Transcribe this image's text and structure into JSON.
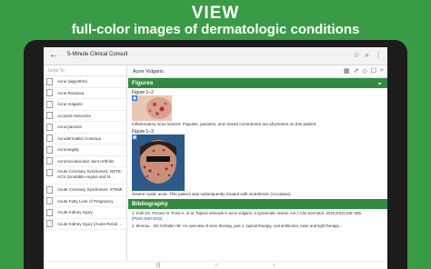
{
  "promo": {
    "headline": "VIEW",
    "subheadline": "full-color images of dermatologic conditions"
  },
  "app": {
    "title": "5-Minute Clinical Consult",
    "back_icon": "arrow-back-icon",
    "top_icons": [
      "bookmark-icon",
      "search-icon",
      "more-vert-icon"
    ]
  },
  "sidebar": {
    "jump_placeholder": "Jump To",
    "items": [
      {
        "label": "Acne (algorithm)"
      },
      {
        "label": "Acne Rosacea"
      },
      {
        "label": "Acne Vulgaris"
      },
      {
        "label": "Acoustic Neuroma"
      },
      {
        "label": "Acrocyanosis"
      },
      {
        "label": "Acrodermatitis Continua"
      },
      {
        "label": "Acromegaly"
      },
      {
        "label": "Acromioclavicular Joint Arthritis"
      },
      {
        "label": "Acute Coronary Syndromes: NSTE-ACS (Unstable Angina and N..."
      },
      {
        "label": "Acute Coronary Syndromes: STEMI"
      },
      {
        "label": "Acute Fatty Liver of Pregnancy"
      },
      {
        "label": "Acute Kidney Injury"
      },
      {
        "label": "Acute Kidney Injury (Acute Renal ..."
      }
    ]
  },
  "content": {
    "topic": "Acne Vulgaris",
    "figures_header": "Figures",
    "figure1_label": "Figure 1–2",
    "figure1_caption": "Inflammatory acne lesions: Papules, pustules, and closed comedones are all present on this patient.",
    "figure2_label": "Figure 1–3",
    "figure2_caption": "Severe cystic acne. This patient was subsequently treated with isotretinoin (Accutane).",
    "biblio_header": "Bibliography",
    "ref1_text": "1. Kolli SS, Pecone D, Pona A, et al. Topical retinoids in acne vulgaris: a systematic review. Am J Clin Dermatol. 2019;20(3):345–365.",
    "ref1_link": "[PMID:30674002]",
    "ref2_text": "2. Moreau... BV Schaller HE: An overview of acne therapy, part 1: topical therapy, oral antibiotics, laser and light therapy..."
  },
  "colors": {
    "background": "#3a9b46",
    "section_header": "#338a3e"
  }
}
